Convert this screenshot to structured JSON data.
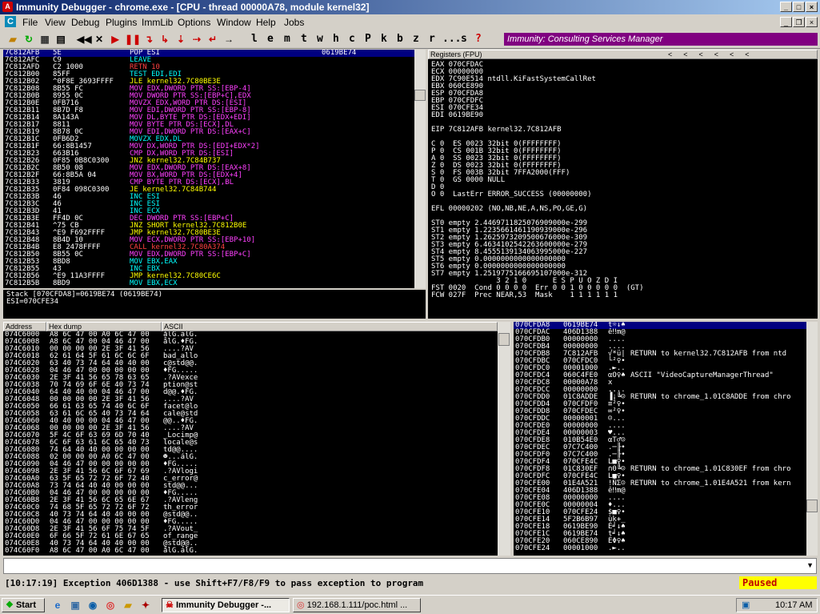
{
  "window": {
    "title": "Immunity Debugger - chrome.exe - [CPU - thread 00000A78, module kernel32]"
  },
  "menu": [
    "File",
    "View",
    "Debug",
    "Plugins",
    "ImmLib",
    "Options",
    "Window",
    "Help",
    "Jobs"
  ],
  "toolbar": {
    "letters": [
      "l",
      "e",
      "m",
      "t",
      "w",
      "h",
      "c",
      "P",
      "k",
      "b",
      "z",
      "r",
      "...",
      "s",
      "?"
    ],
    "banner": "Immunity: Consulting Services Manager"
  },
  "disasm": {
    "sel_addr": "7C812AFB",
    "rows": [
      [
        "7C812AFB",
        "5E",
        "POP ESI",
        "0619BE74",
        "w"
      ],
      [
        "7C812AFC",
        "C9",
        "LEAVE",
        "",
        "c"
      ],
      [
        "7C812AFD",
        "C2 1000",
        "RETN 10",
        "",
        "r"
      ],
      [
        "7C812B00",
        "85FF",
        "TEST EDI,EDI",
        "",
        "c"
      ],
      [
        "7C812B02",
        "^0F8E 3693FFFF",
        "JLE kernel32.7C80BE3E",
        "",
        "y"
      ],
      [
        "7C812B08",
        "8B55 FC",
        "MOV EDX,DWORD PTR SS:[EBP-4]",
        "",
        "m"
      ],
      [
        "7C812B0B",
        "8955 0C",
        "MOV DWORD PTR SS:[EBP+C],EDX",
        "",
        "m"
      ],
      [
        "7C812B0E",
        "0FB716",
        "MOVZX EDX,WORD PTR DS:[ESI]",
        "",
        "m"
      ],
      [
        "7C812B11",
        "8B7D F8",
        "MOV EDI,DWORD PTR SS:[EBP-8]",
        "",
        "m"
      ],
      [
        "7C812B14",
        "8A143A",
        "MOV DL,BYTE PTR DS:[EDX+EDI]",
        "",
        "m"
      ],
      [
        "7C812B17",
        "8811",
        "MOV BYTE PTR DS:[ECX],DL",
        "",
        "m"
      ],
      [
        "7C812B19",
        "8B78 0C",
        "MOV EDI,DWORD PTR DS:[EAX+C]",
        "",
        "m"
      ],
      [
        "7C812B1C",
        "0FB6D2",
        "MOVZX EDX,DL",
        "",
        "c"
      ],
      [
        "7C812B1F",
        "66:8B1457",
        "MOV DX,WORD PTR DS:[EDI+EDX*2]",
        "",
        "m"
      ],
      [
        "7C812B23",
        "663B16",
        "CMP DX,WORD PTR DS:[ESI]",
        "",
        "m"
      ],
      [
        "7C812B26",
        "0F85 0B8C0300",
        "JNZ kernel32.7C84B737",
        "",
        "y"
      ],
      [
        "7C812B2C",
        "8B50 08",
        "MOV EDX,DWORD PTR DS:[EAX+8]",
        "",
        "m"
      ],
      [
        "7C812B2F",
        "66:8B5A 04",
        "MOV BX,WORD PTR DS:[EDX+4]",
        "",
        "m"
      ],
      [
        "7C812B33",
        "3819",
        "CMP BYTE PTR DS:[ECX],BL",
        "",
        "m"
      ],
      [
        "7C812B35",
        "0F84 098C0300",
        "JE kernel32.7C84B744",
        "",
        "y"
      ],
      [
        "7C812B3B",
        "46",
        "INC ESI",
        "",
        "c"
      ],
      [
        "7C812B3C",
        "46",
        "INC ESI",
        "",
        "c"
      ],
      [
        "7C812B3D",
        "41",
        "INC ECX",
        "",
        "c"
      ],
      [
        "7C812B3E",
        "FF4D 0C",
        "DEC DWORD PTR SS:[EBP+C]",
        "",
        "m"
      ],
      [
        "7C812B41",
        "^75 CB",
        "JNZ SHORT kernel32.7C812B0E",
        "",
        "y"
      ],
      [
        "7C812B43",
        "^E9 F692FFFF",
        "JMP kernel32.7C80BE3E",
        "",
        "y"
      ],
      [
        "7C812B48",
        "8B4D 10",
        "MOV ECX,DWORD PTR SS:[EBP+10]",
        "",
        "m"
      ],
      [
        "7C812B4B",
        "E8 2478FFFF",
        "CALL kernel32.7C80A374",
        "",
        "r"
      ],
      [
        "7C812B50",
        "8B55 0C",
        "MOV EDX,DWORD PTR SS:[EBP+C]",
        "",
        "m"
      ],
      [
        "7C812B53",
        "8BD8",
        "MOV EBX,EAX",
        "",
        "c"
      ],
      [
        "7C812B55",
        "43",
        "INC EBX",
        "",
        "c"
      ],
      [
        "7C812B56",
        "^E9 11A3FFFF",
        "JMP kernel32.7C80CE6C",
        "",
        "y"
      ],
      [
        "7C812B5B",
        "8BD9",
        "MOV EBX,ECX",
        "",
        "c"
      ]
    ],
    "info": [
      "Stack [070CFDA8]=0619BE74 (0619BE74)",
      "ESI=070CFE34"
    ]
  },
  "registers": {
    "header": "Registers (FPU)",
    "lines": [
      "EAX 070CFDAC",
      "ECX 00000000",
      "EDX 7C90E514 ntdll.KiFastSystemCallRet",
      "EBX 060CE890",
      "ESP 070CFDA8",
      "EBP 070CFDFC",
      "ESI 070CFE34",
      "EDI 0619BE90",
      "",
      "EIP 7C812AFB kernel32.7C812AFB",
      "",
      "C 0  ES 0023 32bit 0(FFFFFFFF)",
      "P 0  CS 001B 32bit 0(FFFFFFFF)",
      "A 0  SS 0023 32bit 0(FFFFFFFF)",
      "Z 0  DS 0023 32bit 0(FFFFFFFF)",
      "S 0  FS 003B 32bit 7FFA2000(FFF)",
      "T 0  GS 0000 NULL",
      "D 0",
      "O 0  LastErr ERROR_SUCCESS (00000000)",
      "",
      "EFL 00000202 (NO,NB,NE,A,NS,PO,GE,G)",
      "",
      "ST0 empty 2.4469711825076909000e-299",
      "ST1 empty 1.2235661461190939000e-296",
      "ST2 empty 1.2625973209500676000e-309",
      "ST3 empty 6.4634102542263600000e-279",
      "ST4 empty 8.4555139134063995000e-227",
      "ST5 empty 0.0000000000000000000",
      "ST6 empty 0.0000000000000000000",
      "ST7 empty 1.2519775166695107000e-312",
      "               3 2 1 0      E S P U O Z D I",
      "FST 0020  Cond 0 0 0 0  Err 0 0 1 0 0 0 0 0  (GT)",
      "FCW 027F  Prec NEAR,53  Mask    1 1 1 1 1 1"
    ]
  },
  "dump": {
    "headers": [
      "Address",
      "Hex dump",
      "ASCII"
    ],
    "rows": [
      [
        "074C6000",
        "A8 6C 47 00 A0 6C 47 00",
        "ålG.álG."
      ],
      [
        "074C6008",
        "A8 6C 47 00 04 46 47 00",
        "ålG.♦FG."
      ],
      [
        "074C6010",
        "00 00 00 00 2E 3F 41 56",
        "....?AV"
      ],
      [
        "074C6018",
        "62 61 64 5F 61 6C 6C 6F",
        "bad_allo"
      ],
      [
        "074C6020",
        "63 40 73 74 64 40 40 00",
        "c@std@@."
      ],
      [
        "074C6028",
        "04 46 47 00 00 00 00 00",
        "♦FG....."
      ],
      [
        "074C6030",
        "2E 3F 41 56 65 78 63 65",
        ".?AVexce"
      ],
      [
        "074C6038",
        "70 74 69 6F 6E 40 73 74",
        "ption@st"
      ],
      [
        "074C6040",
        "64 40 40 00 04 46 47 00",
        "d@@.♦FG."
      ],
      [
        "074C6048",
        "00 00 00 00 2E 3F 41 56",
        "....?AV"
      ],
      [
        "074C6050",
        "66 61 63 65 74 40 6C 6F",
        "facet@lo"
      ],
      [
        "074C6058",
        "63 61 6C 65 40 73 74 64",
        "cale@std"
      ],
      [
        "074C6060",
        "40 40 00 00 04 46 47 00",
        "@@..♦FG."
      ],
      [
        "074C6068",
        "00 00 00 00 2E 3F 41 56",
        "....?AV"
      ],
      [
        "074C6070",
        "5F 4C 6F 63 69 6D 70 40",
        "_Locimp@"
      ],
      [
        "074C6078",
        "6C 6F 63 61 6C 65 40 73",
        "locale@s"
      ],
      [
        "074C6080",
        "74 64 40 40 00 00 00 00",
        "td@@...."
      ],
      [
        "074C6088",
        "02 00 00 00 A0 6C 47 00",
        "☻...álG."
      ],
      [
        "074C6090",
        "04 46 47 00 00 00 00 00",
        "♦FG....."
      ],
      [
        "074C6098",
        "2E 3F 41 56 6C 6F 67 69",
        ".?AVlogi"
      ],
      [
        "074C60A0",
        "63 5F 65 72 72 6F 72 40",
        "c_error@"
      ],
      [
        "074C60A8",
        "73 74 64 40 40 00 00 00",
        "std@@..."
      ],
      [
        "074C60B0",
        "04 46 47 00 00 00 00 00",
        "♦FG....."
      ],
      [
        "074C60B8",
        "2E 3F 41 56 6C 65 6E 67",
        ".?AVleng"
      ],
      [
        "074C60C0",
        "74 68 5F 65 72 72 6F 72",
        "th_error"
      ],
      [
        "074C60C8",
        "40 73 74 64 40 40 00 00",
        "@std@@.."
      ],
      [
        "074C60D0",
        "04 46 47 00 00 00 00 00",
        "♦FG....."
      ],
      [
        "074C60D8",
        "2E 3F 41 56 6F 75 74 5F",
        ".?AVout_"
      ],
      [
        "074C60E0",
        "6F 66 5F 72 61 6E 67 65",
        "of_range"
      ],
      [
        "074C60E8",
        "40 73 74 64 40 40 00 00",
        "@std@@.."
      ],
      [
        "074C60F0",
        "A8 6C 47 00 A0 6C 47 00",
        "ålG.álG."
      ]
    ]
  },
  "stack": {
    "rows": [
      [
        "070CFDA8",
        "0619BE74",
        "t☼↓♠",
        ""
      ],
      [
        "070CFDAC",
        "406D1388",
        "ê‼m@",
        ""
      ],
      [
        "070CFDB0",
        "00000000",
        "....",
        ""
      ],
      [
        "070CFDB4",
        "00000000",
        "....",
        ""
      ],
      [
        "070CFDB8",
        "7C812AFB",
        "√*ü|",
        "RETURN to kernel32.7C812AFB from ntd"
      ],
      [
        "070CFDBC",
        "070CFDC0",
        "└²♀•",
        ""
      ],
      [
        "070CFDC0",
        "00001000",
        ".►..",
        ""
      ],
      [
        "070CFDC4",
        "060C4FE0",
        "αO♀♠",
        "ASCII \"VideoCaptureManagerThread\""
      ],
      [
        "070CFDC8",
        "00000A78",
        "x\n..",
        ""
      ],
      [
        "070CFDCC",
        "00000000",
        "....",
        ""
      ],
      [
        "070CFDD0",
        "01C8ADDE",
        "▐¡╚☺",
        "RETURN to chrome_1.01C8ADDE from chro"
      ],
      [
        "070CFDD4",
        "070CFDF0",
        "≡²♀•",
        ""
      ],
      [
        "070CFDD8",
        "070CFDEC",
        "∞²♀•",
        ""
      ],
      [
        "070CFDDC",
        "00000001",
        "☺...",
        ""
      ],
      [
        "070CFDE0",
        "00000000",
        "....",
        ""
      ],
      [
        "070CFDE4",
        "00000003",
        "♥...",
        ""
      ],
      [
        "070CFDE8",
        "010B54E0",
        "αT♂☺",
        ""
      ],
      [
        "070CFDEC",
        "07C7C400",
        ".─╟•",
        ""
      ],
      [
        "070CFDF0",
        "07C7C400",
        ".─╟•",
        ""
      ],
      [
        "070CFDF4",
        "070CFE4C",
        "L■♀•",
        ""
      ],
      [
        "070CFDF8",
        "01C830EF",
        "∩0╚☺",
        "RETURN to chrome_1.01C830EF from chro"
      ],
      [
        "070CFDFC",
        "070CFE4C",
        "L■♀•",
        ""
      ],
      [
        "070CFE00",
        "01E4A521",
        "!ÑΣ☺",
        "RETURN to chrome_1.01E4A521 from kern"
      ],
      [
        "070CFE04",
        "406D1388",
        "ê‼m@",
        ""
      ],
      [
        "070CFE08",
        "00000000",
        "....",
        ""
      ],
      [
        "070CFE0C",
        "00000004",
        "♦...",
        ""
      ],
      [
        "070CFE10",
        "070CFE24",
        "$■♀•",
        ""
      ],
      [
        "070CFE14",
        "5F2B6B97",
        "ùk+_",
        ""
      ],
      [
        "070CFE18",
        "0619BE90",
        "É╛↓♠",
        ""
      ],
      [
        "070CFE1C",
        "0619BE74",
        "t╛↓♠",
        ""
      ],
      [
        "070CFE20",
        "060CE890",
        "ÉΦ♀♠",
        ""
      ],
      [
        "070CFE24",
        "00001000",
        ".►..",
        ""
      ]
    ]
  },
  "status": {
    "message": "[10:17:19] Exception 406D1388 - use Shift+F7/F8/F9 to pass exception to program",
    "state": "Paused"
  },
  "taskbar": {
    "start": "Start",
    "tasks": [
      "Immunity Debugger -...",
      "192.168.1.111/poc.html ..."
    ],
    "clock": "10:17 AM"
  }
}
